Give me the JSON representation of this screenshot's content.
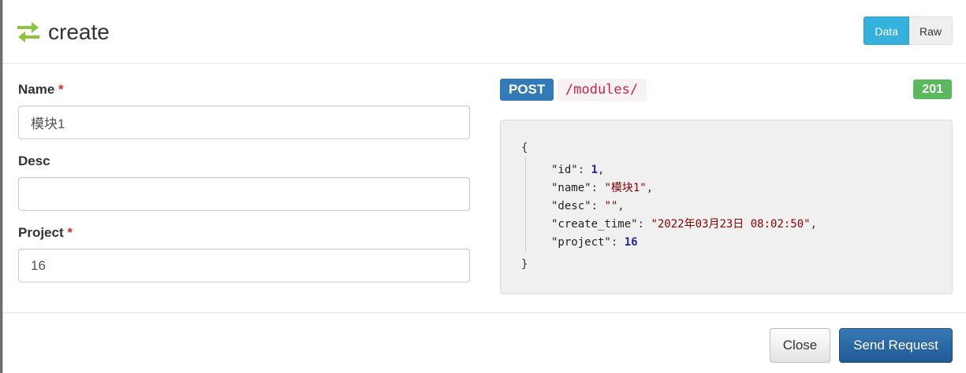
{
  "header": {
    "title": "create",
    "icon": "swap-arrows-icon",
    "accent_color": "#8cc63f",
    "toggle": {
      "data_label": "Data",
      "raw_label": "Raw",
      "active": "Data"
    }
  },
  "form": {
    "fields": [
      {
        "label": "Name",
        "required": true,
        "value": "模块1",
        "placeholder": ""
      },
      {
        "label": "Desc",
        "required": false,
        "value": "",
        "placeholder": ""
      },
      {
        "label": "Project",
        "required": true,
        "value": "16",
        "placeholder": ""
      }
    ],
    "required_marker": "*"
  },
  "request": {
    "method": "POST",
    "url": "/modules/",
    "status": "201"
  },
  "response": {
    "open": "{",
    "close": "}",
    "lines": [
      {
        "key": "\"id\"",
        "value": "1",
        "type": "num",
        "comma": ","
      },
      {
        "key": "\"name\"",
        "value": "\"模块1\"",
        "type": "str",
        "comma": ","
      },
      {
        "key": "\"desc\"",
        "value": "\"\"",
        "type": "str",
        "comma": ","
      },
      {
        "key": "\"create_time\"",
        "value": "\"2022年03月23日 08:02:50\"",
        "type": "str",
        "comma": ","
      },
      {
        "key": "\"project\"",
        "value": "16",
        "type": "num",
        "comma": ""
      }
    ]
  },
  "footer": {
    "close_label": "Close",
    "send_label": "Send Request"
  },
  "colors": {
    "method": "#337ab7",
    "status": "#5cb85c",
    "toggle_active": "#35b1de",
    "send": "#286090"
  }
}
